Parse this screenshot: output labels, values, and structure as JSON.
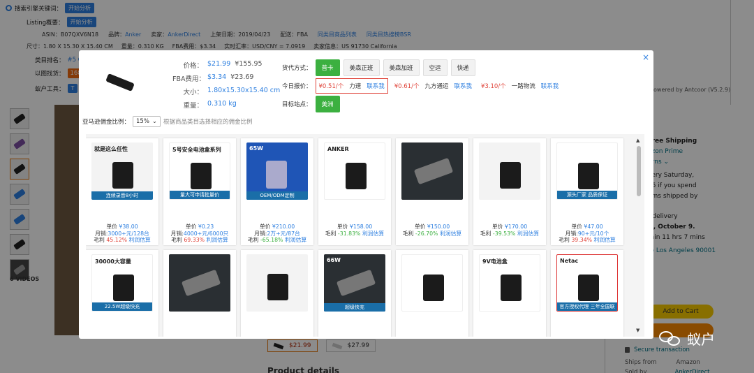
{
  "toolbar": {
    "index_label": "搜索引擎关键词：",
    "index_btn": "开始分析",
    "listing_label": "Listing概要：",
    "listing_btn": "开始分析",
    "category_label": "类目排名：",
    "category_value": "#5 C",
    "similar_label": "以图找货：",
    "similar_value": "168",
    "tools_label": "蚁户工具：",
    "tools_value": "T"
  },
  "background_info": {
    "asin": "ASIN：B07QXV6N18",
    "brand": "品牌：",
    "brand_value": "Anker",
    "seller": "卖家：",
    "seller_value": "AnkerDirect",
    "listed": "上架日期：2019/04/23",
    "fulfil": "配送：FBA",
    "same_cat": "同类目商品列表",
    "same_bsr": "同类目热搜榜BSR",
    "size": "尺寸：1.80 X 15.30 X 15.40 CM",
    "weight": "重量：0.310 KG",
    "fba": "FBA费用：$3.34",
    "rate": "实时汇率：USD/CNY = 7.0919",
    "seller_info": "卖家信息：US 91730 California",
    "powered": "owered by Antcoor (V5.2.9)"
  },
  "background_right": {
    "free_ship": "Free Shipping",
    "prime": "azon Prime",
    "returns": "urns ⌄",
    "delivery": "very Saturday,",
    "spend": "15 if you spend",
    "shipped": "ems shipped by",
    "t_delivery": "t delivery",
    "october": "w, October 9.",
    "within": "thin 11 hrs 7 mins",
    "la": "to Los Angeles 90001",
    "add_cart": "Add to Cart",
    "secure": "Secure transaction",
    "ships_from": "Ships from",
    "ships_value": "Amazon",
    "sold_by": "Sold by",
    "sold_value": "AnkerDirect",
    "price_a": "$21.99",
    "price_b": "$27.99",
    "product_details": "Product details",
    "videos": "6 VIDEOS"
  },
  "modal": {
    "close": "×",
    "price_label": "价格：",
    "price_usd": "$21.99",
    "price_cny": "¥155.95",
    "fba_label": "FBA费用：",
    "fba_usd": "$3.34",
    "fba_cny": "¥23.69",
    "size_label": "大小：",
    "size_value": "1.80x15.30x15.40 cm",
    "weight_label": "重量：",
    "weight_value": "0.310 kg",
    "ship_label": "货代方式：",
    "ship_options": [
      "普卡",
      "美森正班",
      "美森加班",
      "空运",
      "快递"
    ],
    "quote_label": "今日报价：",
    "quotes": [
      {
        "price": "¥0.51/个",
        "name": "力速",
        "contact": "联系我"
      },
      {
        "price": "¥0.61/个",
        "name": "九方通运",
        "contact": "联系我"
      },
      {
        "price": "¥3.10/个",
        "name": "一路物流",
        "contact": "联系我"
      }
    ],
    "dest_label": "目标站点：",
    "dest_value": "美洲",
    "commission_label": "亚马逊佣金比例：",
    "commission_value": "15%",
    "commission_hint": "根据商品类目选择相应的佣金比例",
    "scroll_up": "▲",
    "scroll_down": "▼"
  },
  "products": [
    {
      "img_title": "就是这么任性",
      "img_strip": "连续录音8小时",
      "unit_label": "单价",
      "unit": "¥38.00",
      "sales_label": "月销:",
      "sales": "3000+元/128台",
      "margin_label": "毛利",
      "margin": "45.12%",
      "calc": "利润估算",
      "margin_color": "r"
    },
    {
      "img_title": "5号安全电池盒系列",
      "img_strip": "量大可申请批量价",
      "unit_label": "单价",
      "unit": "¥0.23",
      "sales_label": "月销:",
      "sales": "4000+元/6000只",
      "margin_label": "毛利",
      "margin": "69.33%",
      "calc": "利润估算",
      "margin_color": "r"
    },
    {
      "img_title": "65W",
      "img_strip": "OEM/ODM定制",
      "unit_label": "单价",
      "unit": "¥210.00",
      "sales_label": "月销:",
      "sales": "2万+元/87台",
      "margin_label": "毛利",
      "margin": "-65.18%",
      "calc": "利润估算",
      "margin_color": "g"
    },
    {
      "img_title": "ANKER",
      "img_strip": "",
      "unit_label": "单价",
      "unit": "¥158.00",
      "sales_label": "毛利",
      "sales": "",
      "margin_label": "毛利",
      "margin": "-31.83%",
      "calc": "利润估算",
      "margin_color": "g"
    },
    {
      "img_title": "",
      "img_strip": "",
      "unit_label": "单价",
      "unit": "¥150.00",
      "sales_label": "毛利",
      "sales": "",
      "margin_label": "毛利",
      "margin": "-26.70%",
      "calc": "利润估算",
      "margin_color": "g"
    },
    {
      "img_title": "",
      "img_strip": "",
      "unit_label": "单价",
      "unit": "¥170.00",
      "sales_label": "毛利",
      "sales": "",
      "margin_label": "毛利",
      "margin": "-39.53%",
      "calc": "利润估算",
      "margin_color": "g"
    },
    {
      "img_title": "",
      "img_strip": "源头厂家 品质保证",
      "unit_label": "单价",
      "unit": "¥47.00",
      "sales_label": "月销:",
      "sales": "90+元/10个",
      "margin_label": "毛利",
      "margin": "39.34%",
      "calc": "利润估算",
      "margin_color": "r"
    },
    {
      "img_title": "30000大容量",
      "img_strip": "22.5W超级快充",
      "unit_label": "",
      "unit": "",
      "sales_label": "",
      "sales": "",
      "margin_label": "",
      "margin": "",
      "calc": "",
      "margin_color": "r"
    },
    {
      "img_title": "",
      "img_strip": "",
      "unit_label": "",
      "unit": "",
      "sales_label": "",
      "sales": "",
      "margin_label": "",
      "margin": "",
      "calc": "",
      "margin_color": "r"
    },
    {
      "img_title": "",
      "img_strip": "",
      "unit_label": "",
      "unit": "",
      "sales_label": "",
      "sales": "",
      "margin_label": "",
      "margin": "",
      "calc": "",
      "margin_color": "r"
    },
    {
      "img_title": "66W",
      "img_strip": "超级快充",
      "unit_label": "",
      "unit": "",
      "sales_label": "",
      "sales": "",
      "margin_label": "",
      "margin": "",
      "calc": "",
      "margin_color": "r"
    },
    {
      "img_title": "",
      "img_strip": "",
      "unit_label": "",
      "unit": "",
      "sales_label": "",
      "sales": "",
      "margin_label": "",
      "margin": "",
      "calc": "",
      "margin_color": "r"
    },
    {
      "img_title": "9V电池盒",
      "img_strip": "",
      "unit_label": "",
      "unit": "",
      "sales_label": "",
      "sales": "",
      "margin_label": "",
      "margin": "",
      "calc": "",
      "margin_color": "r"
    },
    {
      "img_title": "Netac",
      "img_strip": "官方授权代理 三年全国联保",
      "unit_label": "",
      "unit": "",
      "sales_label": "",
      "sales": "",
      "margin_label": "",
      "margin": "",
      "calc": "",
      "margin_color": "r"
    }
  ],
  "watermark": "蚁户"
}
